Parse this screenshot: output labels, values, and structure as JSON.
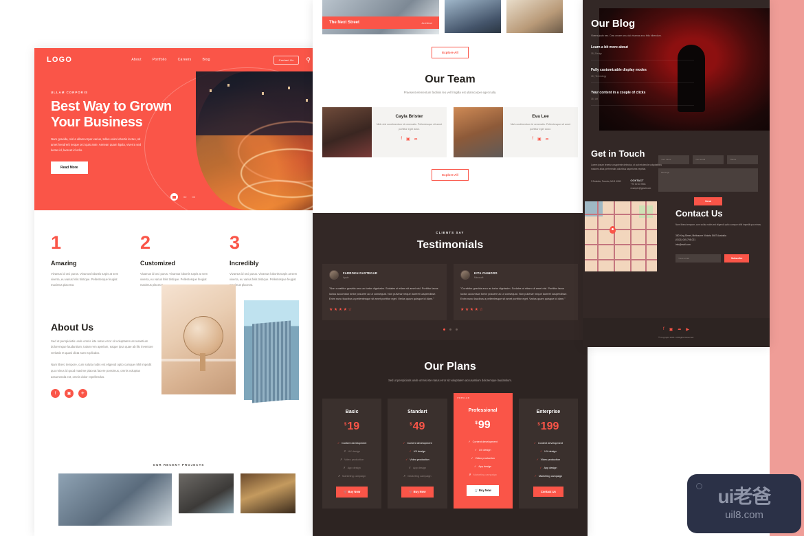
{
  "brand": {
    "accent": "#fa5548",
    "dark": "#332826",
    "darker": "#2d2422"
  },
  "header": {
    "logo": "LOGO",
    "nav": [
      {
        "label": "About"
      },
      {
        "label": "Portfolio"
      },
      {
        "label": "Careers"
      },
      {
        "label": "Blog"
      }
    ],
    "contact_button": "Contact Us",
    "search_icon": "search-icon"
  },
  "hero": {
    "eyebrow": "ULLAM CORPORIS",
    "title_line1": "Best Way to Grown",
    "title_line2": "Your Business",
    "paragraph": "Nam gravida, nisl a ullamcorper varius, tellus enim lobortis lectus, sit amet hendrerit neque orci quis ante. Aenean quam ligula, viverra sed luctus id, laoreet id odio.",
    "cta": "Read More",
    "slide_indicators": [
      "01",
      "02",
      "03"
    ]
  },
  "features": [
    {
      "num": "1",
      "title": "Amazing",
      "desc": "Vivamus id orci purus. Vivamus lobortis turpis at sem viverra, eu varius felis tristique. Pellentesque feugiat maximus placerat."
    },
    {
      "num": "2",
      "title": "Customized",
      "desc": "Vivamus id orci purus. Vivamus lobortis turpis at sem viverra, eu varius felis tristique. Pellentesque feugiat maximus placerat."
    },
    {
      "num": "3",
      "title": "Incredibly",
      "desc": "Vivamus id orci purus. Vivamus lobortis turpis at sem viverra, eu varius felis tristique. Pellentesque feugiat maximus placerat."
    }
  ],
  "about": {
    "title": "About Us",
    "paragraph1": "Sed ut perspiciatis unde omnis iste natus error sit voluptatem accusantium doloremque laudantium, totam rem aperiam, eaque ipsa quae ab illo inventore veritatis et quasi dicta sunt explicabo.",
    "paragraph2": "Nam libero tempore, cum soluta nobis est eligendi optio cumque nihil impedit quo minus id quod maxime placeat facere possimus, omnis voluptas assumenda est, omnis dolor repellendus.",
    "socials": [
      {
        "icon": "facebook-icon",
        "glyph": "f"
      },
      {
        "icon": "instagram-icon",
        "glyph": "▣"
      },
      {
        "icon": "twitter-icon",
        "glyph": "✈"
      }
    ],
    "image1_alt": "globe-on-shelf-photo",
    "image2_alt": "skyscraper-photo"
  },
  "recent_projects": {
    "label": "OUR RECENT PROJECTS",
    "items": [
      {
        "alt": "city-building-photo"
      },
      {
        "alt": "man-at-window-photo"
      },
      {
        "alt": "bookshelf-photo"
      }
    ]
  },
  "portfolio": {
    "featured": {
      "title": "The Next Street",
      "category": "Architect"
    },
    "thumbs": [
      {
        "alt": "city-skyline-photo"
      },
      {
        "alt": "desk-workspace-photo"
      }
    ],
    "explore_label": "Explore All"
  },
  "team": {
    "title": "Our Team",
    "subtitle": "Praesent elementum facilisis leo vel fringilla est ullamcorper eget nulla.",
    "members": [
      {
        "name": "Cayla Brister",
        "desc": "Nibh nisl condimentum id venenatis. Pellentesque sit amet porttitor eget dolor.",
        "socials": [
          "facebook-icon",
          "instagram-icon",
          "twitter-icon"
        ]
      },
      {
        "name": "Eva Lee",
        "desc": "Nisl condimentum id venenatis. Pellentesque sit amet porttitor eget dolor.",
        "socials": [
          "facebook-icon",
          "instagram-icon",
          "twitter-icon"
        ]
      }
    ],
    "explore_label": "Explore All"
  },
  "testimonials": {
    "eyebrow": "CLIENTS SAY",
    "title": "Testimonials",
    "items": [
      {
        "name": "FARROKH RASTEGAR",
        "company": "Apple",
        "quote": "\"Non curabitur gravida arcu ac tortor dignissim. Sodales ut etiam sit amet nisl. Porttitor lacus luctus accumsan tortor posuere ac ut consequat. Non pulvinar neque laoreet suspendisse. Enim nunc faucibus a pellentesque sit amet porttitor eget. Varius quam quisque id diam.\"",
        "rating": 4,
        "stars_total": 5
      },
      {
        "name": "KITA CHIHORO",
        "company": "Microsoft",
        "quote": "\"Curabitur gravida arcu ac tortor dignissim. Sodales ut etiam sit amet nisl. Porttitor lacus luctus accumsan tortor posuere ac ut consequat. Non pulvinar neque laoreet suspendisse. Enim nunc faucibus a pellentesque sit amet porttitor eget. Varius quam quisque id diam.\"",
        "rating": 4,
        "stars_total": 5
      }
    ],
    "dots": 3,
    "active_dot": 0
  },
  "plans": {
    "title": "Our Plans",
    "subtitle": "Sed ut perspiciatis unde omnis iste natus error sit voluptatem accusantium doloremque laudantium.",
    "popular_tag": "POPULAR",
    "items": [
      {
        "name": "Basic",
        "currency": "$",
        "price": "19",
        "features": [
          {
            "label": "Content development",
            "included": true
          },
          {
            "label": "UX design",
            "included": false
          },
          {
            "label": "Video production",
            "included": false
          },
          {
            "label": "App design",
            "included": false
          },
          {
            "label": "Marketing campaign",
            "included": false
          }
        ],
        "cta": "Buy Now",
        "cta_icon": "cart-icon",
        "popular": false
      },
      {
        "name": "Standart",
        "currency": "$",
        "price": "49",
        "features": [
          {
            "label": "Content development",
            "included": true
          },
          {
            "label": "UX design",
            "included": true
          },
          {
            "label": "Video production",
            "included": true
          },
          {
            "label": "App design",
            "included": false
          },
          {
            "label": "Marketing campaign",
            "included": false
          }
        ],
        "cta": "Buy Now",
        "cta_icon": "cart-icon",
        "popular": false
      },
      {
        "name": "Professional",
        "currency": "$",
        "price": "99",
        "features": [
          {
            "label": "Content development",
            "included": true
          },
          {
            "label": "UX design",
            "included": true
          },
          {
            "label": "Video production",
            "included": true
          },
          {
            "label": "App design",
            "included": true
          },
          {
            "label": "Marketing campaign",
            "included": false
          }
        ],
        "cta": "Buy Now",
        "cta_icon": "cart-icon",
        "popular": true
      },
      {
        "name": "Enterprise",
        "currency": "$",
        "price": "199",
        "features": [
          {
            "label": "Content development",
            "included": true
          },
          {
            "label": "UX design",
            "included": true
          },
          {
            "label": "Video production",
            "included": true
          },
          {
            "label": "App design",
            "included": true
          },
          {
            "label": "Marketing campaign",
            "included": true
          }
        ],
        "cta": "Contact Us",
        "cta_icon": "",
        "popular": false
      }
    ]
  },
  "blog": {
    "title": "Our Blog",
    "subtitle": "Viverra justo nec. Cras ornare arcu dui vivamus arcu felis bibendum.",
    "items": [
      {
        "title": "Learn a bit more about",
        "meta": "18 | Design"
      },
      {
        "title": "Fully customizable display modes",
        "meta": "18 | Technology"
      },
      {
        "title": "Your content in a couple of clicks",
        "meta": "18 | Art"
      }
    ],
    "hero_alt": "hooded-figure-red-photo"
  },
  "get_in_touch": {
    "title": "Get in Touch",
    "subtitle": "Lorem ipsum tenetur a sapiente delectus, ut aut reiciendis voluptatibus maiores alias perferendis doloribus asperiores repellat.",
    "contact_label": "CONTACT",
    "address": "3 Dolecito, Toronto, M1G 4V80",
    "phone": "+70 00 43 7861",
    "email": "example@gmail.com",
    "form": {
      "name_placeholder": "Your name",
      "email_placeholder": "Your email",
      "theme_placeholder": "Theme",
      "message_placeholder": "Message",
      "send_label": "Send"
    }
  },
  "contact_us": {
    "title": "Contact Us",
    "subtitle": "Nam libero tempore, cum soluta nobis est eligendi optio cumque nihil impedit quo minus.",
    "address": "350 King Street, Melbourne Victoria 5467 Australia",
    "phone": "(0321) 045-798-021",
    "email": "info@mail.com",
    "email_placeholder": "Youre email",
    "subscribe_label": "Subscribe",
    "map_alt": "street-map",
    "map_pin": "location-pin-icon"
  },
  "footer": {
    "socials": [
      "facebook-icon",
      "instagram-icon",
      "twitter-icon",
      "youtube-icon"
    ],
    "copyright": "© Copyright 2018. All Rights Reserved."
  },
  "watermark": {
    "brand": "ui老爸",
    "url": "uil8.com"
  }
}
